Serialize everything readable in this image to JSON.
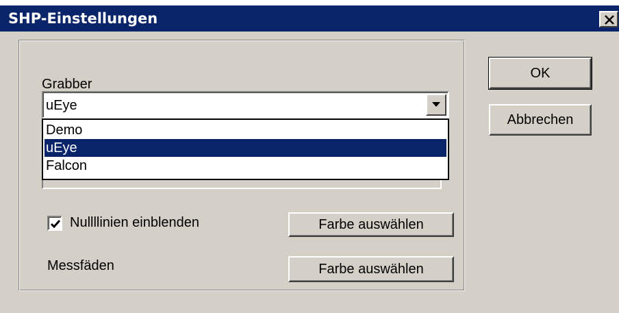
{
  "window": {
    "title": "SHP-Einstellungen"
  },
  "grabber": {
    "label": "Grabber",
    "selected": "uEye",
    "options": [
      "Demo",
      "uEye",
      "Falcon"
    ]
  },
  "null_lines": {
    "label": "Nullllinien einblenden",
    "checked": true,
    "color_button": "Farbe auswählen"
  },
  "crosshair": {
    "label": "Messfäden",
    "color_button": "Farbe auswählen"
  },
  "buttons": {
    "ok": "OK",
    "cancel": "Abbrechen"
  },
  "colors": {
    "titlebar": "#0a246a",
    "face": "#d4d0c8",
    "selection": "#0a246a"
  }
}
